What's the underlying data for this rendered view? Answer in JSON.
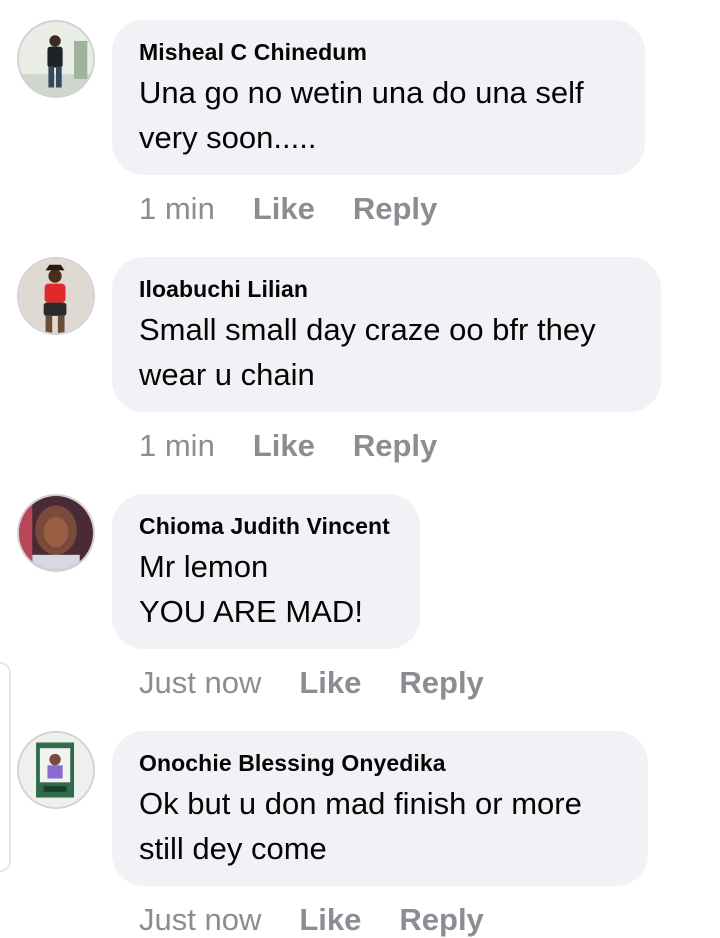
{
  "comments": [
    {
      "author": "Misheal C Chinedum",
      "lines": [
        "Una go no wetin una do una self",
        "very soon....."
      ],
      "time": "1 min",
      "like": "Like",
      "reply": "Reply",
      "avatar_icon": "man-standing-photo-icon"
    },
    {
      "author": "Iloabuchi Lilian",
      "lines": [
        "Small small day craze oo bfr they",
        "wear u chain"
      ],
      "time": "1 min",
      "like": "Like",
      "reply": "Reply",
      "avatar_icon": "woman-red-top-photo-icon"
    },
    {
      "author": "Chioma Judith Vincent",
      "lines": [
        "Mr lemon",
        "YOU ARE MAD!"
      ],
      "time": "Just now",
      "like": "Like",
      "reply": "Reply",
      "avatar_icon": "woman-portrait-photo-icon"
    },
    {
      "author": "Onochie Blessing Onyedika",
      "lines": [
        "Ok but u don mad finish or more",
        "still dey come"
      ],
      "time": "Just now",
      "like": "Like",
      "reply": "Reply",
      "avatar_icon": "printed-photo-frame-icon"
    }
  ],
  "colors": {
    "bubble_bg": "#f0f2f5",
    "text": "#050505",
    "meta": "#8a8d91"
  }
}
